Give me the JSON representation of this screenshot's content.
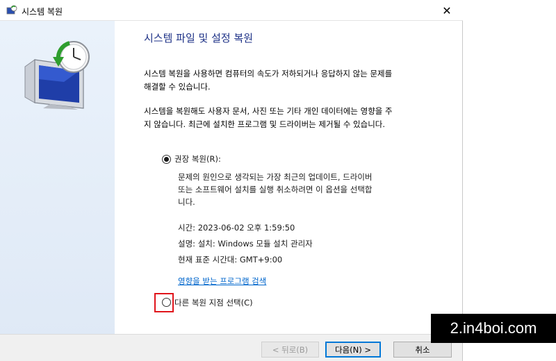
{
  "window": {
    "title": "시스템 복원",
    "close_glyph": "✕"
  },
  "main": {
    "heading": "시스템 파일 및 설정 복원",
    "para1_line1": "시스템 복원을 사용하면 컴퓨터의 속도가 저하되거나 응답하지 않는 문제를",
    "para1_line2": "해결할 수 있습니다.",
    "para2_line1": "시스템을 복원해도 사용자 문서, 사진 또는 기타 개인 데이터에는 영향을 주",
    "para2_line2": "지 않습니다. 최근에 설치한 프로그램 및 드라이버는 제거될 수 있습니다.",
    "option_recommended": {
      "label": "권장 복원(R):",
      "checked": true,
      "desc_line1": "문제의 원인으로 생각되는 가장 최근의 업데이트, 드라이버",
      "desc_line2": "또는 소프트웨어 설치를 실행 취소하려면 이 옵션을 선택합",
      "desc_line3": "니다.",
      "time": "시간: 2023-06-02 오후 1:59:50",
      "description": "설명: 설치: Windows 모듈 설치 관리자",
      "timezone": "현재 표준 시간대: GMT+9:00",
      "link": "영향을 받는 프로그램 검색"
    },
    "option_other": {
      "label": "다른 복원 지점 선택(C)",
      "checked": false
    }
  },
  "footer": {
    "back_label": "< 뒤로(B)",
    "next_label": "다음(N) >",
    "cancel_label": "취소"
  },
  "watermark": "2.in4boi.com",
  "colors": {
    "heading": "#1e3287",
    "link": "#0066cc",
    "highlight": "#e0141b",
    "accent": "#0078d7"
  }
}
